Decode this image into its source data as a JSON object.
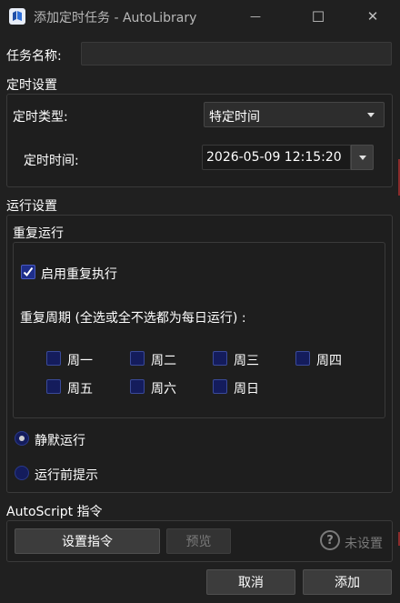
{
  "window": {
    "title": "添加定时任务 - AutoLibrary",
    "minimize_glyph": "—",
    "maximize_glyph": "☐",
    "close_glyph": "✕"
  },
  "task_name": {
    "label": "任务名称:",
    "value": ""
  },
  "schedule": {
    "section_title": "定时设置",
    "type_label": "定时类型:",
    "type_value": "特定时间",
    "time_label": "定时时间:",
    "time_value": "2026-05-09 12:15:20"
  },
  "run": {
    "section_title": "运行设置",
    "repeat_group_title": "重复运行",
    "enable_repeat_label": "启用重复执行",
    "enable_repeat_checked": true,
    "period_label": "重复周期 (全选或全不选都为每日运行) :",
    "weekdays": [
      {
        "label": "周一",
        "checked": false
      },
      {
        "label": "周二",
        "checked": false
      },
      {
        "label": "周三",
        "checked": false
      },
      {
        "label": "周四",
        "checked": false
      },
      {
        "label": "周五",
        "checked": false
      },
      {
        "label": "周六",
        "checked": false
      },
      {
        "label": "周日",
        "checked": false
      }
    ],
    "silent_label": "静默运行",
    "prompt_label": "运行前提示",
    "selected_mode": "静默运行"
  },
  "script": {
    "section_title": "AutoScript 指令",
    "set_button": "设置指令",
    "preview_button": "预览",
    "help_glyph": "?",
    "status": "未设置"
  },
  "footer": {
    "cancel_button": "取消",
    "add_button": "添加"
  },
  "colors": {
    "background": "#202020",
    "panel": "#1e1e1e",
    "checkbox_fill": "#141c5c",
    "check_mark": "#ffffff",
    "disabled_text": "#7a7a7a"
  }
}
